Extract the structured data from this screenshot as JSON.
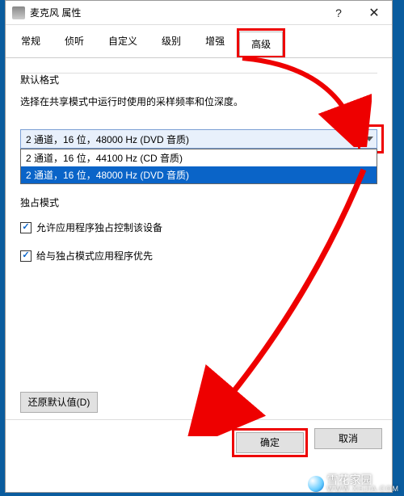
{
  "titlebar": {
    "title": "麦克风 属性"
  },
  "tabs": {
    "items": [
      "常规",
      "侦听",
      "自定义",
      "级别",
      "增强",
      "高级"
    ],
    "active": "高级"
  },
  "defaultFormat": {
    "group": "默认格式",
    "desc": "选择在共享模式中运行时使用的采样频率和位深度。",
    "selected": "2 通道，16 位，48000 Hz (DVD 音质)",
    "options": [
      "2 通道，16 位，44100 Hz (CD 音质)",
      "2 通道，16 位，48000 Hz (DVD 音质)"
    ],
    "highlightedIndex": 1
  },
  "exclusive": {
    "group": "独占模式",
    "chk1": "允许应用程序独占控制该设备",
    "chk2": "给与独占模式应用程序优先"
  },
  "buttons": {
    "restore": "还原默认值(D)",
    "ok": "确定",
    "cancel": "取消"
  },
  "watermark": {
    "name": "雪花家园",
    "sub": "WWW.XHJIA.COM"
  }
}
